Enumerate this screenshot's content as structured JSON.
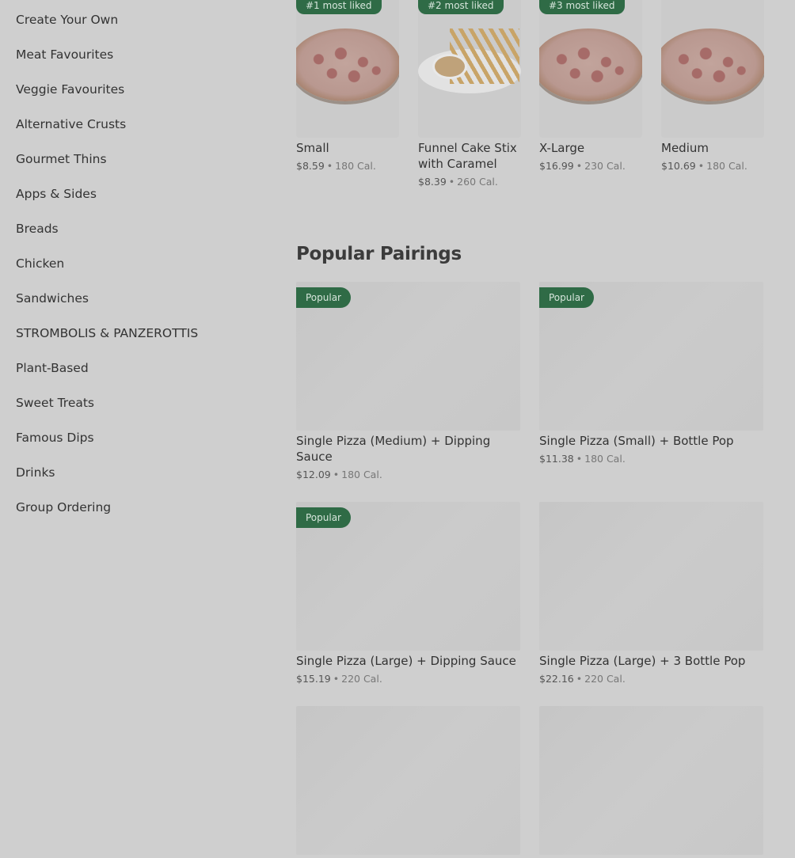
{
  "sidebar": {
    "items": [
      {
        "label": "Create Your Own"
      },
      {
        "label": "Meat Favourites"
      },
      {
        "label": "Veggie Favourites"
      },
      {
        "label": "Alternative Crusts"
      },
      {
        "label": "Gourmet Thins"
      },
      {
        "label": "Apps & Sides"
      },
      {
        "label": "Breads"
      },
      {
        "label": "Chicken"
      },
      {
        "label": "Sandwiches"
      },
      {
        "label": "STROMBOLIS & PANZEROTTIS"
      },
      {
        "label": "Plant-Based"
      },
      {
        "label": "Sweet Treats"
      },
      {
        "label": "Famous Dips"
      },
      {
        "label": "Drinks"
      },
      {
        "label": "Group Ordering"
      }
    ]
  },
  "top_items": [
    {
      "badge": "#1 most liked",
      "title": "Small",
      "price": "$8.59",
      "cal": "180 Cal.",
      "image": "pizza"
    },
    {
      "badge": "#2 most liked",
      "title": "Funnel Cake Stix with Caramel",
      "price": "$8.39",
      "cal": "260 Cal.",
      "image": "fries"
    },
    {
      "badge": "#3 most liked",
      "title": "X-Large",
      "price": "$16.99",
      "cal": "230 Cal.",
      "image": "pizza"
    },
    {
      "badge": "",
      "title": "Medium",
      "price": "$10.69",
      "cal": "180 Cal.",
      "image": "pizza"
    }
  ],
  "separator": "•",
  "popular_pairings": {
    "heading": "Popular Pairings",
    "badge": "Popular",
    "items": [
      {
        "title": "Single Pizza (Medium) + Dipping Sauce",
        "price": "$12.09",
        "cal": "180 Cal.",
        "popular": true
      },
      {
        "title": "Single Pizza (Small) + Bottle Pop",
        "price": "$11.38",
        "cal": "180 Cal.",
        "popular": true
      },
      {
        "title": "Single Pizza (Large) + Dipping Sauce",
        "price": "$15.19",
        "cal": "220 Cal.",
        "popular": true
      },
      {
        "title": "Single Pizza (Large) + 3 Bottle Pop",
        "price": "$22.16",
        "cal": "220 Cal.",
        "popular": false
      }
    ]
  },
  "colors": {
    "background": "#cfcfcf",
    "badge_green": "#2f6b46",
    "text": "#333333"
  }
}
